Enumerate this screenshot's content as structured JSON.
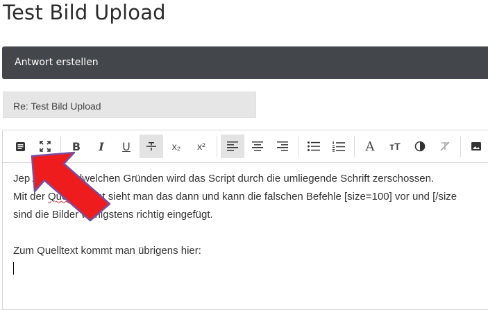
{
  "page": {
    "title": "Test Bild Upload"
  },
  "header": {
    "label": "Antwort erstellen"
  },
  "subject": {
    "value": "Re: Test Bild Upload"
  },
  "toolbar": {
    "bold": "B",
    "italic": "I",
    "underline": "U",
    "strike": "S",
    "subscript": "x₂",
    "superscript": "x²",
    "font": "A",
    "font_size": "тT"
  },
  "editor": {
    "line1_a": "Jep",
    "line1_b": " Aus irgendwelchen Gründen wird das Script durch die umliegende Schrift zerschossen.",
    "line2_a": "Mit der ",
    "line2_spell": "Quellansicht",
    "line2_b": " sieht man das dann und kann die falschen Befehle [size=100] vor und [/size",
    "line3": "sind die Bilder wenigstens richtig eingefügt.",
    "line5": "Zum Quelltext kommt man übrigens hier:"
  },
  "colors": {
    "header_bg": "#43464b",
    "arrow_fill": "#ee1c1c",
    "arrow_border": "#7a4fa0"
  }
}
